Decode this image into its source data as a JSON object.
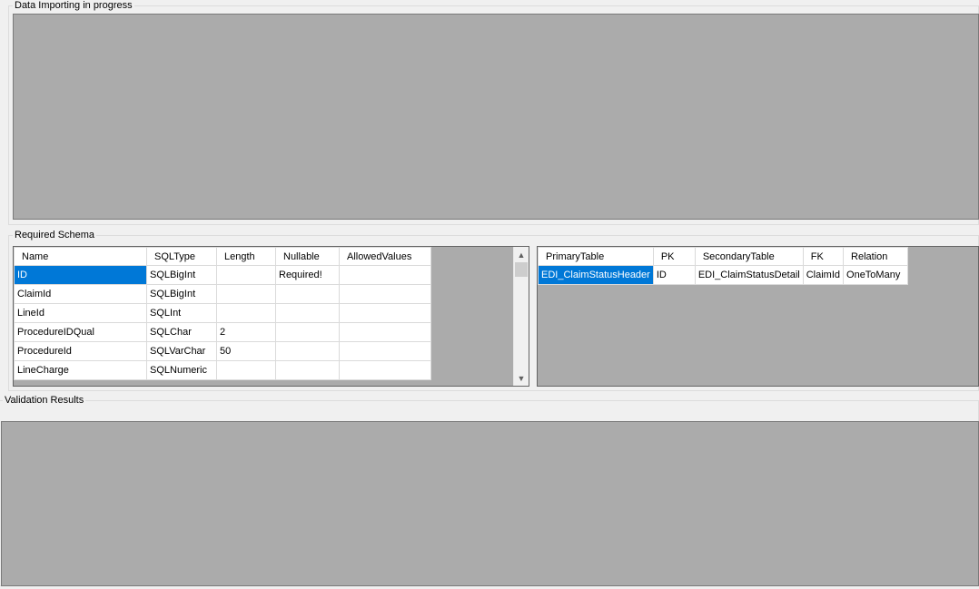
{
  "importing": {
    "title": "Data Importing in progress"
  },
  "schema": {
    "title": "Required Schema",
    "columns": [
      "Name",
      "SQLType",
      "Length",
      "Nullable",
      "AllowedValues"
    ],
    "rows": [
      [
        "ID",
        "SQLBigInt",
        "",
        "Required!",
        ""
      ],
      [
        "ClaimId",
        "SQLBigInt",
        "",
        "",
        ""
      ],
      [
        "LineId",
        "SQLInt",
        "",
        "",
        ""
      ],
      [
        "ProcedureIDQual",
        "SQLChar",
        "2",
        "",
        ""
      ],
      [
        "ProcedureId",
        "SQLVarChar",
        "50",
        "",
        ""
      ],
      [
        "LineCharge",
        "SQLNumeric",
        "",
        "",
        ""
      ]
    ],
    "scroll_up": "▲",
    "scroll_down": "▼"
  },
  "relations": {
    "columns": [
      "PrimaryTable",
      "PK",
      "SecondaryTable",
      "FK",
      "Relation"
    ],
    "rows": [
      [
        "EDI_ClaimStatusHeader",
        "ID",
        "EDI_ClaimStatusDetail",
        "ClaimId",
        "OneToMany"
      ]
    ]
  },
  "validation": {
    "title": "Validation Results"
  }
}
